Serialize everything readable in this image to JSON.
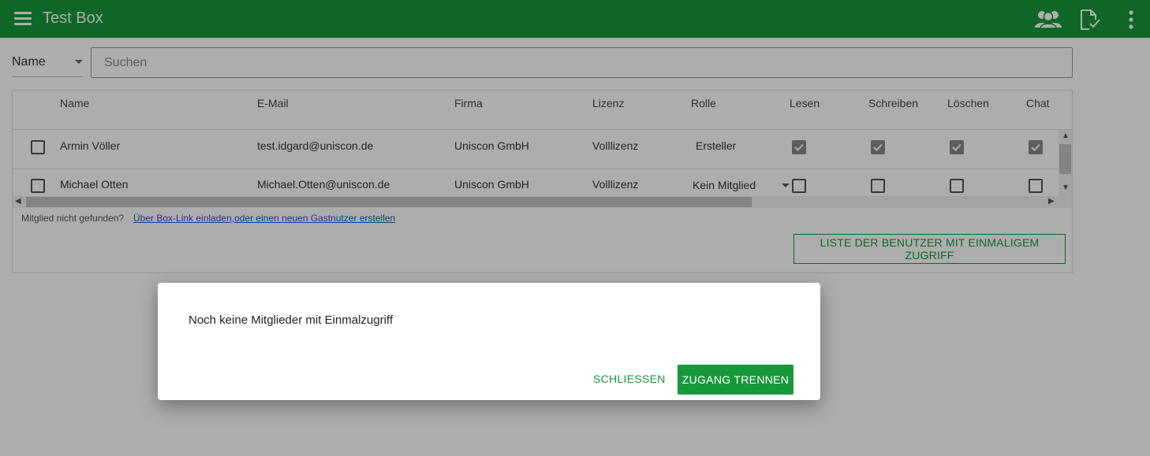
{
  "header": {
    "title": "Test Box",
    "icons": [
      "menu-icon",
      "members-icon",
      "document-check-icon",
      "more-vert-icon"
    ]
  },
  "filter": {
    "field": "Name",
    "search_placeholder": "Suchen"
  },
  "table": {
    "columns": [
      "Name",
      "E-Mail",
      "Firma",
      "Lizenz",
      "Rolle",
      "Lesen",
      "Schreiben",
      "Löschen",
      "Chat"
    ],
    "rows": [
      {
        "name": "Armin Völler",
        "email": "test.idgard@uniscon.de",
        "firma": "Uniscon GmbH",
        "lizenz": "Volllizenz",
        "rolle": "Ersteller",
        "lesen": true,
        "schreiben": true,
        "loeschen": true,
        "chat": true
      },
      {
        "name": "Michael Otten",
        "email": "Michael.Otten@uniscon.de",
        "firma": "Uniscon GmbH",
        "lizenz": "Volllizenz",
        "rolle": "Kein Mitglied",
        "lesen": false,
        "schreiben": false,
        "loeschen": false,
        "chat": false
      }
    ]
  },
  "footer": {
    "not_found": "Mitglied nicht gefunden?",
    "invite_link": "Über Box-Link einladen,oder einen neuen Gastnutzer erstellen",
    "list_button": "LISTE DER BENUTZER MIT EINMALIGEM ZUGRIFF"
  },
  "dialog": {
    "message": "Noch keine Mitglieder mit Einmalzugriff",
    "close_label": "SCHLIESSEN",
    "disconnect_label": "ZUGANG TRENNEN"
  },
  "colors": {
    "brand": "#17993a",
    "link": "#1a5fb4",
    "overlay": "rgba(0,0,0,0.32)"
  }
}
